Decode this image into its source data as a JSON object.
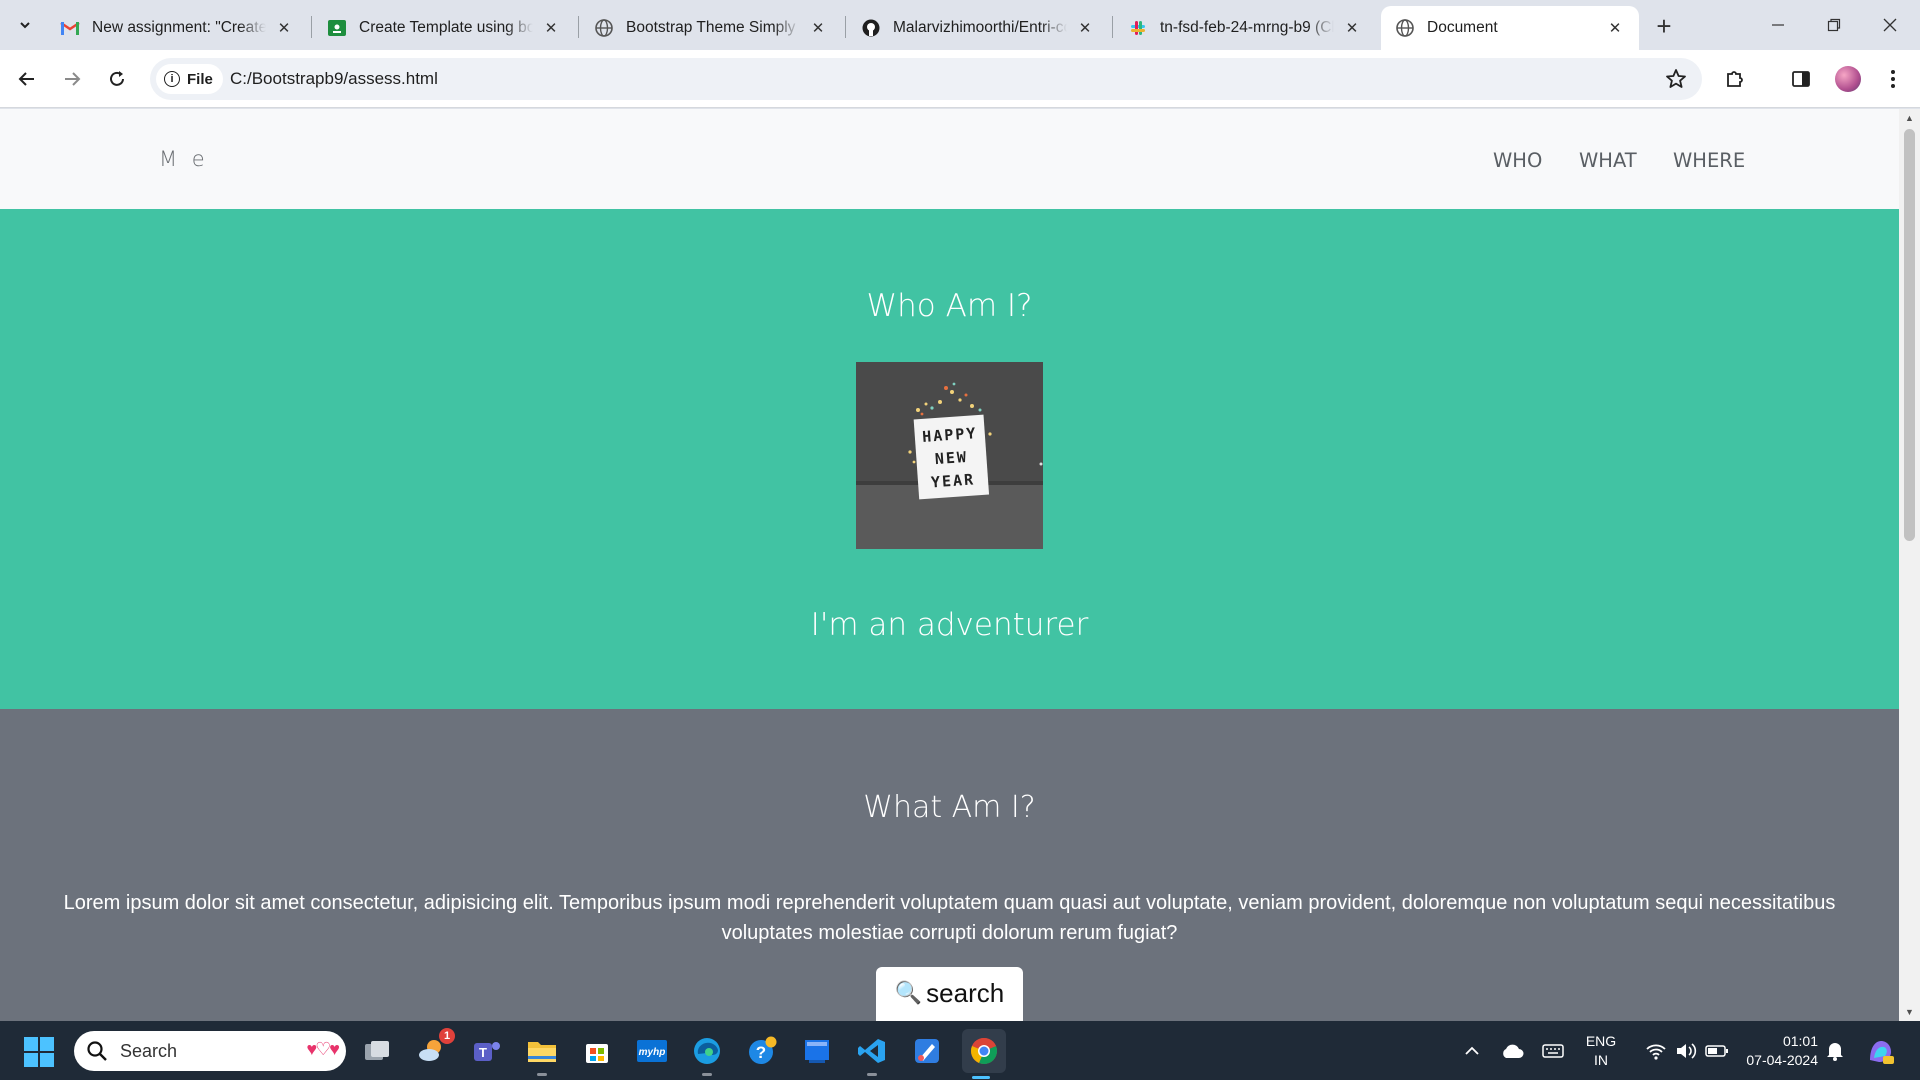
{
  "browser": {
    "tabs": [
      {
        "title": "New assignment: \"Create T",
        "icon": "gmail-icon",
        "close": "✕"
      },
      {
        "title": "Create Template using boo",
        "icon": "classroom-icon",
        "close": "✕"
      },
      {
        "title": "Bootstrap Theme Simply M",
        "icon": "globe-icon",
        "close": "✕"
      },
      {
        "title": "Malarvizhimoorthi/Entri-co",
        "icon": "github-icon",
        "close": "✕"
      },
      {
        "title": "tn-fsd-feb-24-mrng-b9 (Cl",
        "icon": "slack-icon",
        "close": "✕"
      },
      {
        "title": "Document",
        "icon": "globe-icon",
        "close": "✕"
      }
    ],
    "new_tab": "+",
    "site_chip": "File",
    "url": "C:/Bootstrapb9/assess.html"
  },
  "page": {
    "navbar": {
      "brand": "M e",
      "links": [
        "WHO",
        "WHAT",
        "WHERE"
      ]
    },
    "who": {
      "title": "Who Am I?",
      "image_sign": [
        "HAPPY",
        "NEW",
        "YEAR"
      ],
      "tagline": "I'm an adventurer"
    },
    "what": {
      "title": "What Am I?",
      "paragraph": "Lorem ipsum dolor sit amet consectetur, adipisicing elit. Temporibus ipsum modi reprehenderit voluptatem quam quasi aut voluptate, veniam provident, doloremque non voluptatum sequi necessitatibus voluptates molestiae corrupti dolorum rerum fugiat?",
      "search_emoji": "🔍",
      "search_label": "search"
    },
    "colors": {
      "who_bg": "#41c3a3",
      "what_bg": "#6c727c",
      "navbar_bg": "#f8f9fa"
    }
  },
  "taskbar": {
    "search_placeholder": "Search",
    "notification_badge": "1",
    "language": [
      "ENG",
      "IN"
    ],
    "time": "01:01",
    "date": "07-04-2024"
  }
}
